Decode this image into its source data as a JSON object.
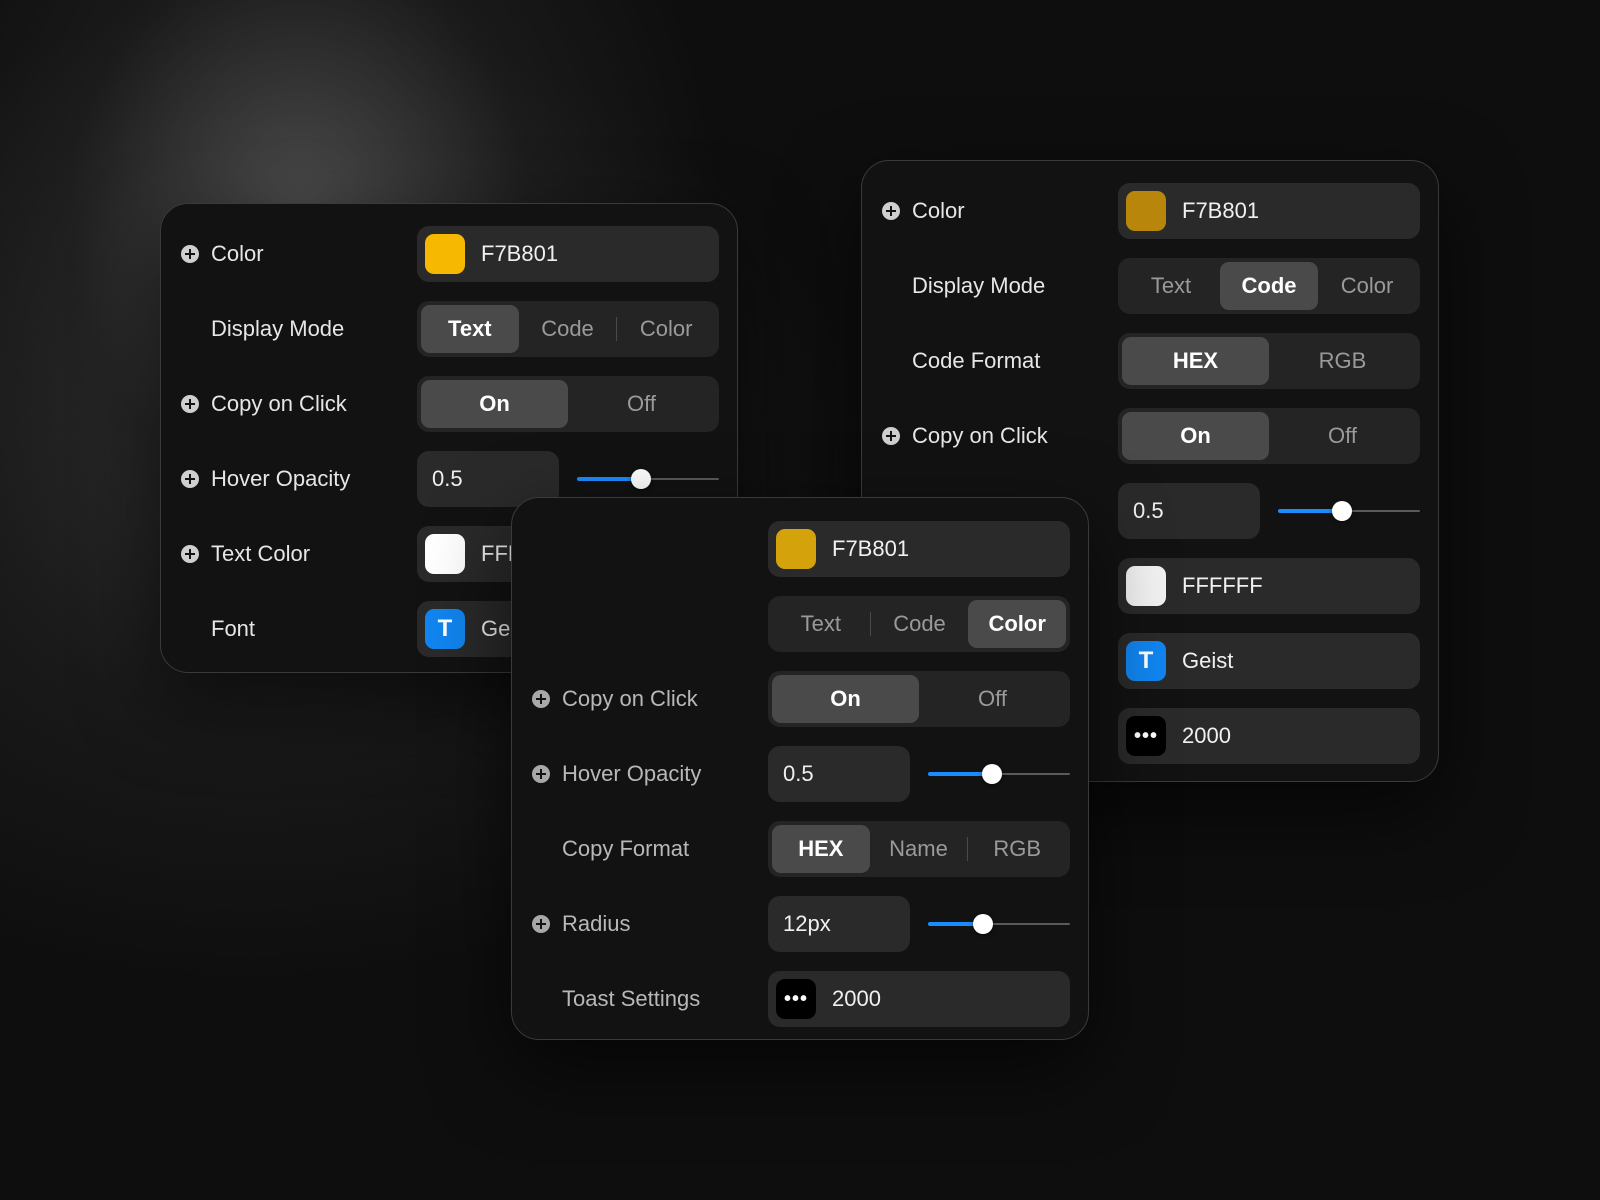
{
  "colors": {
    "gold": "#F7B801",
    "gold_dim": "#B8860B",
    "gold_mid": "#D4A20A",
    "white": "#FFFFFF",
    "accent_blue": "#1185F0"
  },
  "panel_a": {
    "color_label": "Color",
    "color_value": "F7B801",
    "display_mode_label": "Display Mode",
    "display_mode_options": [
      "Text",
      "Code",
      "Color"
    ],
    "display_mode_selected": "Text",
    "copy_on_click_label": "Copy on Click",
    "copy_on_click_options": [
      "On",
      "Off"
    ],
    "copy_on_click_selected": "On",
    "hover_opacity_label": "Hover Opacity",
    "hover_opacity_value": "0.5",
    "hover_opacity_fraction": 0.45,
    "text_color_label": "Text Color",
    "text_color_value": "FFFFFF",
    "font_label": "Font",
    "font_icon": "T",
    "font_value": "Geist"
  },
  "panel_b": {
    "color_label": "Color",
    "color_value": "F7B801",
    "display_mode_label": "Display Mode",
    "display_mode_options": [
      "Text",
      "Code",
      "Color"
    ],
    "display_mode_selected": "Code",
    "code_format_label": "Code Format",
    "code_format_options": [
      "HEX",
      "RGB"
    ],
    "code_format_selected": "HEX",
    "copy_on_click_label": "Copy on Click",
    "copy_on_click_options": [
      "On",
      "Off"
    ],
    "copy_on_click_selected": "On",
    "hover_opacity_value": "0.5",
    "hover_opacity_fraction": 0.45,
    "text_color_value": "FFFFFF",
    "font_icon": "T",
    "font_value": "Geist",
    "toast_icon": "•••",
    "toast_value": "2000"
  },
  "panel_c": {
    "color_value": "F7B801",
    "display_mode_options": [
      "Text",
      "Code",
      "Color"
    ],
    "display_mode_selected": "Color",
    "copy_on_click_label": "Copy on Click",
    "copy_on_click_options": [
      "On",
      "Off"
    ],
    "copy_on_click_selected": "On",
    "hover_opacity_label": "Hover Opacity",
    "hover_opacity_value": "0.5",
    "hover_opacity_fraction": 0.45,
    "copy_format_label": "Copy Format",
    "copy_format_options": [
      "HEX",
      "Name",
      "RGB"
    ],
    "copy_format_selected": "HEX",
    "radius_label": "Radius",
    "radius_value": "12px",
    "radius_fraction": 0.39,
    "toast_label": "Toast Settings",
    "toast_icon": "•••",
    "toast_value": "2000"
  }
}
